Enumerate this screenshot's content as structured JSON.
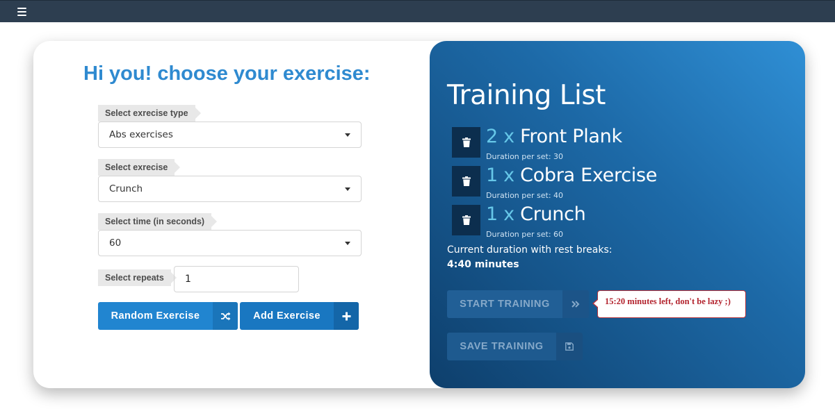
{
  "header": {
    "menu_icon": "hamburger-menu-icon"
  },
  "form": {
    "heading": "Hi you! choose your exercise:",
    "exercise_type": {
      "label": "Select exrecise type",
      "value": "Abs exercises"
    },
    "exercise": {
      "label": "Select exrecise",
      "value": "Crunch"
    },
    "time": {
      "label": "Select time (in seconds)",
      "value": "60"
    },
    "repeats": {
      "label": "Select repeats",
      "value": "1"
    },
    "random_button": {
      "label": "Random Exercise",
      "icon": "shuffle-icon"
    },
    "add_button": {
      "label": "Add Exercise",
      "icon": "plus-icon"
    }
  },
  "training": {
    "title": "Training List",
    "items": [
      {
        "count": "2 x",
        "name": "Front Plank",
        "duration": "Duration per set: 30"
      },
      {
        "count": "1 x",
        "name": "Cobra Exercise",
        "duration": "Duration per set: 40"
      },
      {
        "count": "1 x",
        "name": "Crunch",
        "duration": "Duration per set: 60"
      }
    ],
    "current_label": "Current duration with rest breaks:",
    "current_value": "4:40 minutes",
    "start_button": {
      "label": "START TRAINING",
      "icon": "double-chevron-right-icon"
    },
    "save_button": {
      "label": "SAVE TRAINING",
      "icon": "floppy-disk-icon"
    },
    "tooltip": "15:20 minutes left, don't be lazy ;)"
  },
  "colors": {
    "heading": "#2f8ad0",
    "panel_gradient_start": "#2f8fd5",
    "panel_gradient_end": "#0e3f6c",
    "count_accent": "#66c7e8",
    "tooltip_red": "#b3242e"
  }
}
